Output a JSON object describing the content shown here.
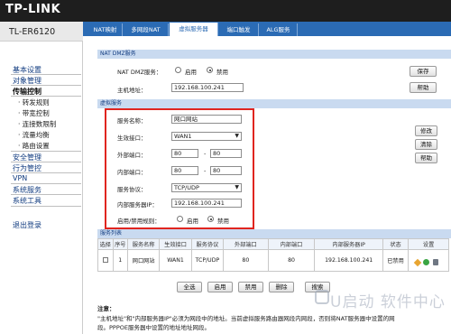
{
  "brand": "TP-LINK",
  "model": "TL-ER6120",
  "tabs": [
    {
      "label": "NAT映射"
    },
    {
      "label": "多网段NAT"
    },
    {
      "label": "虚拟服务器"
    },
    {
      "label": "端口触发"
    },
    {
      "label": "ALG服务"
    }
  ],
  "sidebar": {
    "items": [
      "基本设置",
      "对象管理",
      "传输控制",
      "转发规则",
      "带宽控制",
      "连接数限制",
      "流量均衡",
      "路由设置",
      "安全管理",
      "行为管控",
      "VPN",
      "系统服务",
      "系统工具",
      "退出登录"
    ]
  },
  "dmz": {
    "section": "NAT DMZ服务",
    "service_label": "NAT DMZ服务：",
    "enable": "启用",
    "disable": "禁用",
    "host_label": "主机地址：",
    "host_value": "192.168.100.241",
    "save": "保存",
    "help": "帮助"
  },
  "vs": {
    "section": "虚拟服务",
    "name_label": "服务名称：",
    "name_value": "网口网站",
    "iface_label": "生效接口：",
    "iface_value": "WAN1",
    "ext_label": "外部端口：",
    "ext_from": "80",
    "ext_to": "80",
    "int_label": "内部端口：",
    "int_from": "80",
    "int_to": "80",
    "proto_label": "服务协议：",
    "proto_value": "TCP/UDP",
    "server_label": "内部服务器IP：",
    "server_value": "192.168.100.241",
    "rule_label": "启用/禁用规则：",
    "enable": "启用",
    "disable": "禁用",
    "dash": "-",
    "modify": "修改",
    "clear": "清除",
    "help": "帮助"
  },
  "list": {
    "section": "服务列表",
    "headers": [
      "选择",
      "序号",
      "服务名称",
      "生效接口",
      "服务协议",
      "外部端口",
      "内部端口",
      "内部服务器IP",
      "状态",
      "设置"
    ],
    "row": [
      "",
      "1",
      "网口网站",
      "WAN1",
      "TCP/UDP",
      "80",
      "80",
      "192.168.100.241",
      "已禁用",
      ""
    ],
    "buttons": [
      "全选",
      "启用",
      "禁用",
      "删除",
      "搜索"
    ]
  },
  "note": {
    "title": "注意：",
    "line1": "\"主机地址\"和\"内部服务器IP\"必须为网段中的地址。当前虚拟服务路由器网段内网段，否则将NAT服务器中设置的网",
    "line2": "段。PPPOE服务器中设置的地址地址网段。"
  },
  "watermark": "U启动 软件中心"
}
